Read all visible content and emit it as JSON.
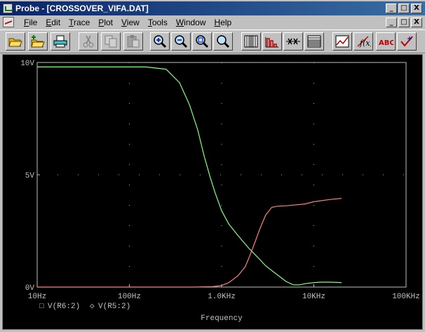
{
  "window": {
    "title": "Probe - [CROSSOVER_VIFA.DAT]",
    "controls": {
      "minimize": "_",
      "maximize": "□",
      "close": "X"
    }
  },
  "menu": {
    "items": [
      {
        "label": "File",
        "key": "F",
        "rest": "ile"
      },
      {
        "label": "Edit",
        "key": "E",
        "rest": "dit"
      },
      {
        "label": "Trace",
        "key": "T",
        "rest": "race"
      },
      {
        "label": "Plot",
        "key": "P",
        "rest": "lot"
      },
      {
        "label": "View",
        "key": "V",
        "rest": "iew"
      },
      {
        "label": "Tools",
        "key": "T",
        "rest": "ools"
      },
      {
        "label": "Window",
        "key": "W",
        "rest": "indow"
      },
      {
        "label": "Help",
        "key": "H",
        "rest": "elp"
      }
    ]
  },
  "toolbar": {
    "buttons": [
      {
        "name": "open-button",
        "icon": "open-folder-icon"
      },
      {
        "name": "append-button",
        "icon": "append-folder-icon"
      },
      {
        "name": "print-button",
        "icon": "printer-icon"
      },
      {
        "name": "cut-button",
        "icon": "scissors-icon"
      },
      {
        "name": "copy-button",
        "icon": "copy-icon"
      },
      {
        "name": "paste-button",
        "icon": "clipboard-icon"
      },
      {
        "name": "zoom-in-button",
        "icon": "zoom-in-icon"
      },
      {
        "name": "zoom-out-button",
        "icon": "zoom-out-icon"
      },
      {
        "name": "zoom-area-button",
        "icon": "zoom-area-icon"
      },
      {
        "name": "zoom-fit-button",
        "icon": "zoom-fit-icon"
      },
      {
        "name": "log-x-axis-button",
        "icon": "log-x-icon"
      },
      {
        "name": "fourier-button",
        "icon": "fft-icon"
      },
      {
        "name": "performance-analysis-button",
        "icon": "performance-icon"
      },
      {
        "name": "log-y-axis-button",
        "icon": "log-y-icon"
      },
      {
        "name": "add-trace-button",
        "icon": "add-trace-icon"
      },
      {
        "name": "eval-goal-button",
        "icon": "function-icon"
      },
      {
        "name": "label-text-button",
        "icon": "abc-text-icon"
      },
      {
        "name": "mark-label-button",
        "icon": "mark-label-icon"
      }
    ],
    "eval_label": "f(x)",
    "abc_label": "ABC"
  },
  "chart_data": {
    "type": "line",
    "xlabel": "Frequency",
    "ylabel": "",
    "x_scale": "log",
    "xlim": [
      10,
      100000
    ],
    "ylim": [
      0,
      10
    ],
    "x_ticks": [
      {
        "value": 10,
        "label": "10Hz"
      },
      {
        "value": 100,
        "label": "100Hz"
      },
      {
        "value": 1000,
        "label": "1.0KHz"
      },
      {
        "value": 10000,
        "label": "10KHz"
      },
      {
        "value": 100000,
        "label": "100KHz"
      }
    ],
    "y_ticks": [
      {
        "value": 0,
        "label": "0V"
      },
      {
        "value": 5,
        "label": "5V"
      },
      {
        "value": 10,
        "label": "10V"
      }
    ],
    "grid": "dotted",
    "series": [
      {
        "name": "V(R6:2)",
        "marker": "□",
        "color": "#80ff80",
        "x": [
          10,
          20,
          40,
          80,
          150,
          250,
          350,
          450,
          550,
          650,
          750,
          850,
          1000,
          1200,
          1500,
          2000,
          2500,
          3000,
          4000,
          5000,
          6000,
          7000,
          8000,
          10000,
          12000,
          15000,
          20000
        ],
        "y": [
          9.8,
          9.8,
          9.8,
          9.8,
          9.8,
          9.7,
          9.1,
          8.1,
          7.0,
          5.8,
          4.9,
          4.2,
          3.4,
          2.8,
          2.3,
          1.7,
          1.3,
          0.95,
          0.55,
          0.25,
          0.1,
          0.1,
          0.15,
          0.2,
          0.22,
          0.22,
          0.2
        ]
      },
      {
        "name": "V(R5:2)",
        "marker": "◇",
        "color": "#ff8080",
        "x": [
          10,
          100,
          500,
          800,
          1000,
          1200,
          1500,
          1800,
          2000,
          2300,
          2600,
          3000,
          3500,
          4000,
          5000,
          6000,
          8000,
          10000,
          15000,
          20000
        ],
        "y": [
          0,
          0,
          0,
          0.02,
          0.07,
          0.2,
          0.5,
          0.9,
          1.35,
          2.0,
          2.6,
          3.2,
          3.55,
          3.6,
          3.62,
          3.65,
          3.7,
          3.8,
          3.9,
          3.95
        ]
      }
    ]
  }
}
